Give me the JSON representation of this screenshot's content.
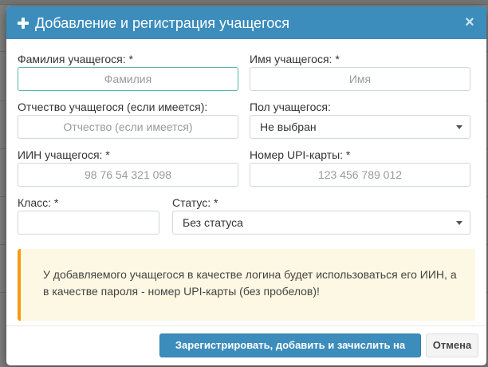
{
  "modal": {
    "title": "Добавление и регистрация учащегося",
    "close_label": "×"
  },
  "form": {
    "last_name": {
      "label": "Фамилия учащегося: *",
      "placeholder": "Фамилия",
      "value": ""
    },
    "first_name": {
      "label": "Имя учащегося: *",
      "placeholder": "Имя",
      "value": ""
    },
    "patronymic": {
      "label": "Отчество учащегося (если имеется):",
      "placeholder": "Отчество (если имеется)",
      "value": ""
    },
    "gender": {
      "label": "Пол учащегося:",
      "selected": "Не выбран"
    },
    "iin": {
      "label": "ИИН учащегося: *",
      "placeholder": "98 76 54 321 098",
      "value": ""
    },
    "upi_card": {
      "label": "Номер UPI-карты: *",
      "placeholder": "123 456 789 012",
      "value": ""
    },
    "class": {
      "label": "Класс: *",
      "placeholder": "",
      "value": ""
    },
    "status": {
      "label": "Статус: *",
      "selected": "Без статуса"
    }
  },
  "notice": {
    "line1": "У добавляемого учащегося в качестве логина будет использоваться его ИИН, а",
    "line2": "в качестве пароля - номер UPI-карты (без пробелов)!"
  },
  "footer": {
    "submit_label": "Зарегистрировать, добавить и зачислить на баланс",
    "cancel_label": "Отмена"
  },
  "colors": {
    "header": "#3c8dbc",
    "alert_bg": "#fcf8e3",
    "alert_border": "#f39c12",
    "focus_border": "#5bb6a2"
  },
  "icons": {
    "title_icon": "plus-icon",
    "close_icon": "close-icon",
    "select_icon": "caret-down-icon"
  }
}
